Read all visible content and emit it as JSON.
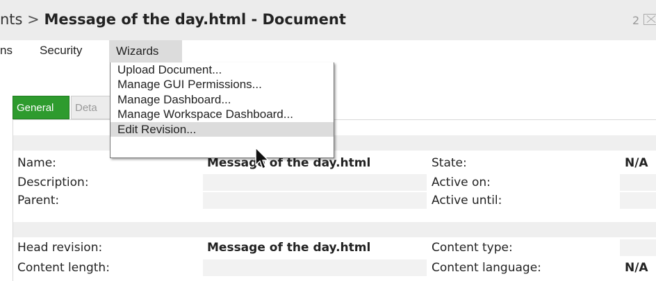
{
  "title": {
    "crumb": "nts",
    "separator": ">",
    "document": "Message of the day.html - Document",
    "count": "2"
  },
  "menubar": {
    "items": [
      "ns",
      "Security",
      "Wizards"
    ]
  },
  "wizards_menu": {
    "items": [
      "Upload Document...",
      "Manage GUI Permissions...",
      "Manage Dashboard...",
      "Manage Workspace Dashboard...",
      "Edit Revision..."
    ],
    "hovered_index": 4
  },
  "tabs": {
    "general": "General",
    "details": "Deta"
  },
  "properties": {
    "name_label": "Name:",
    "name_value": "Message of the day.html",
    "description_label": "Description:",
    "parent_label": "Parent:",
    "state_label": "State:",
    "state_value": "N/A",
    "active_on_label": "Active on:",
    "active_until_label": "Active until:",
    "head_revision_label": "Head revision:",
    "head_revision_value": "Message of the day.html",
    "content_length_label": "Content length:",
    "content_type_label": "Content type:",
    "content_language_label": "Content language:",
    "content_language_value": "N/A"
  },
  "colors": {
    "active_tab": "#2e9b2e",
    "menu_highlight": "#dcdcdc",
    "titlebar": "#ececec"
  }
}
